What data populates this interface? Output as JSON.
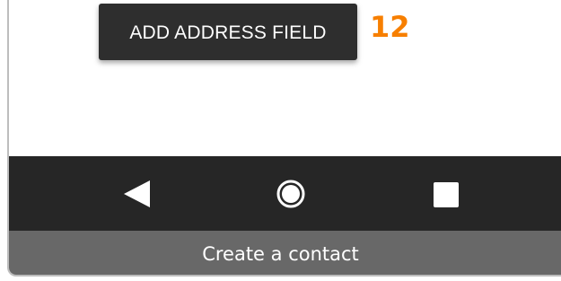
{
  "screen": {
    "add_address_button_label": "ADD ADDRESS FIELD",
    "step_number": "12"
  },
  "nav_bar": {
    "back_icon": "back-triangle-icon",
    "home_icon": "home-circle-icon",
    "recents_icon": "recents-square-icon"
  },
  "caption": {
    "text": "Create a contact"
  },
  "colors": {
    "button_bg": "#2e2e2e",
    "step_number": "#f77f00",
    "nav_bar_bg": "#262626",
    "caption_bg": "#686868"
  }
}
